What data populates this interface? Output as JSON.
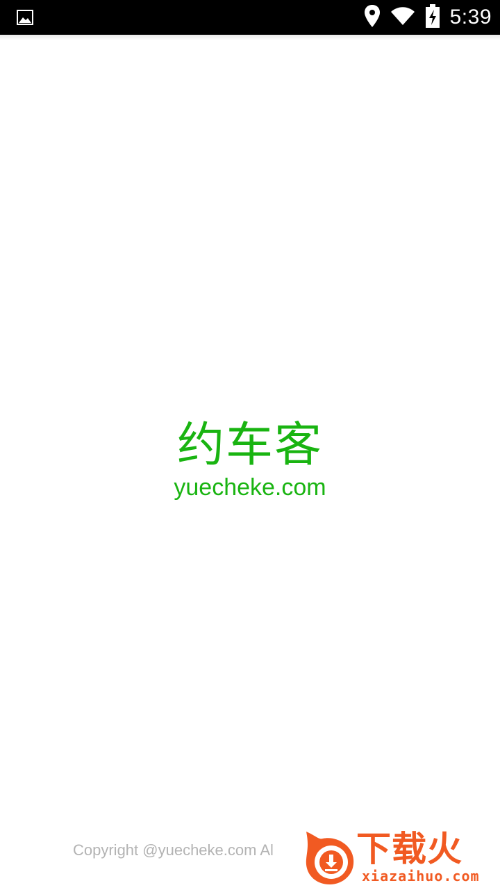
{
  "colors": {
    "brand_green": "#19b411",
    "status_bar": "#000000",
    "watermark_orange": "#f15a22"
  },
  "status_bar": {
    "time": "5:39",
    "icons": [
      "image-notification-icon",
      "location-icon",
      "wifi-icon",
      "battery-charging-icon"
    ]
  },
  "splash": {
    "title": "约车客",
    "url": "yuecheke.com"
  },
  "footer": {
    "copyright": "Copyright @yuecheke.com Al"
  },
  "watermark": {
    "name_cn": "下载火",
    "site": "xiazaihuo.com"
  }
}
